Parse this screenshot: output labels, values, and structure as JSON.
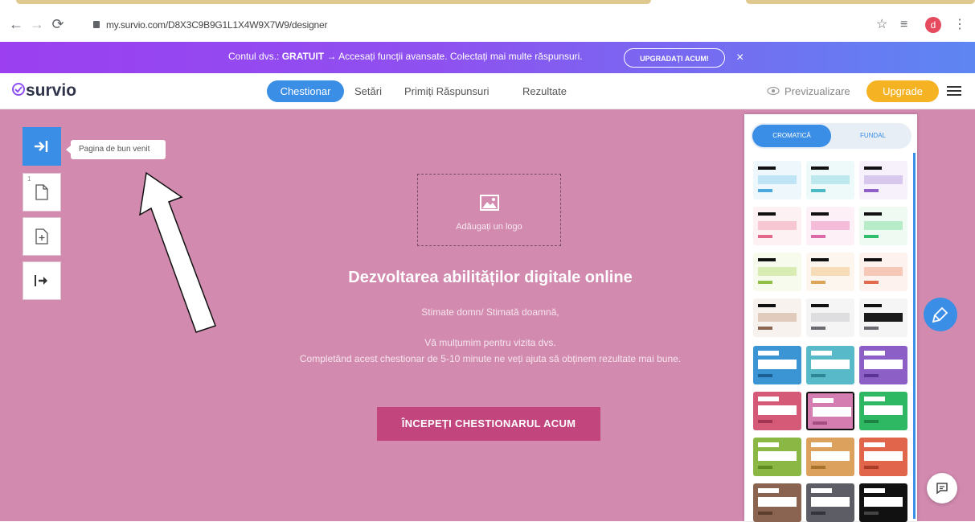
{
  "browser": {
    "url": "my.survio.com/D8X3C9B9G1L1X4W9X7W9/designer",
    "back_icon": "arrow-left-icon",
    "forward_icon": "arrow-right-icon",
    "reload_icon": "reload-icon",
    "star_icon": "star-icon",
    "profile_initial": "d"
  },
  "promo": {
    "prefix": "Contul dvs.: ",
    "plan": "GRATUIT",
    "text": " → Accesați funcții avansate. Colectați mai multe răspunsuri.",
    "button": "UPGRADAȚI ACUM!",
    "close": "×"
  },
  "header": {
    "logo": "survio",
    "nav": [
      "Chestionar",
      "Setări",
      "Primiți Răspunsuri",
      "Rezultate"
    ],
    "preview": "Previzualizare",
    "upgrade": "Upgrade"
  },
  "sidebar": {
    "tooltip": "Pagina de bun venit",
    "page_number": "1"
  },
  "survey": {
    "add_logo": "Adăugați un logo",
    "title": "Dezvoltarea abilităților digitale online",
    "greeting": "Stimate domn/ Stimată doamnă,",
    "thanks": "Vă mulțumim pentru vizita dvs.",
    "body": "Completând acest chestionar de 5-10 minute ne veți ajuta să obținem rezultate mai bune.",
    "start_button": "ÎNCEPEȚI CHESTIONARUL ACUM"
  },
  "theme_panel": {
    "tabs": [
      "CROMATICĂ",
      "FUNDAL"
    ],
    "light_swatches": [
      {
        "bar": "#bfe4f6",
        "accent": "#4aa8dd",
        "bg": "#eef7fc"
      },
      {
        "bar": "#bde9ee",
        "accent": "#4bbac4",
        "bg": "#eef9fa"
      },
      {
        "bar": "#d9c8ee",
        "accent": "#9060c8",
        "bg": "#f6f1fb"
      },
      {
        "bar": "#f6c6d2",
        "accent": "#e06888",
        "bg": "#fdf1f4"
      },
      {
        "bar": "#f5bcd9",
        "accent": "#db6aa6",
        "bg": "#fdf0f7"
      },
      {
        "bar": "#b7ecc9",
        "accent": "#2fbe6e",
        "bg": "#eefaf2"
      },
      {
        "bar": "#d9ecb4",
        "accent": "#8fbf44",
        "bg": "#f6fbee"
      },
      {
        "bar": "#f6dcb7",
        "accent": "#dda55a",
        "bg": "#fdf6ee"
      },
      {
        "bar": "#f6c8b8",
        "accent": "#e26a4c",
        "bg": "#fdf2ee"
      },
      {
        "bar": "#e0cbbd",
        "accent": "#8a6652",
        "bg": "#f8f2ee"
      },
      {
        "bar": "#dedee0",
        "accent": "#6b6b72",
        "bg": "#f5f5f6"
      },
      {
        "bar": "#1a1a1a",
        "accent": "#6b6b72",
        "bg": "#f5f5f6"
      }
    ],
    "dark_swatches": [
      {
        "bg": "#3b95d4",
        "accent": "#1d5e93"
      },
      {
        "bg": "#58b9c9",
        "accent": "#2d8694"
      },
      {
        "bg": "#8b5fc6",
        "accent": "#5a3395"
      },
      {
        "bg": "#d45a78",
        "accent": "#a23553"
      },
      {
        "bg": "#d37db0",
        "accent": "#a24f80",
        "selected": true
      },
      {
        "bg": "#2fb863",
        "accent": "#1c8343"
      },
      {
        "bg": "#8bb845",
        "accent": "#5f8a22"
      },
      {
        "bg": "#dca25d",
        "accent": "#a8732f"
      },
      {
        "bg": "#e0654b",
        "accent": "#a93d27"
      },
      {
        "bg": "#8a6450",
        "accent": "#5c3e2e"
      },
      {
        "bg": "#5d5d66",
        "accent": "#34343c"
      },
      {
        "bg": "#111111",
        "accent": "#444444"
      }
    ]
  },
  "colors": {
    "canvas": "#d28aaf",
    "accent": "#3a8ee6",
    "start_button": "#c2457e",
    "upgrade": "#f5b324"
  }
}
